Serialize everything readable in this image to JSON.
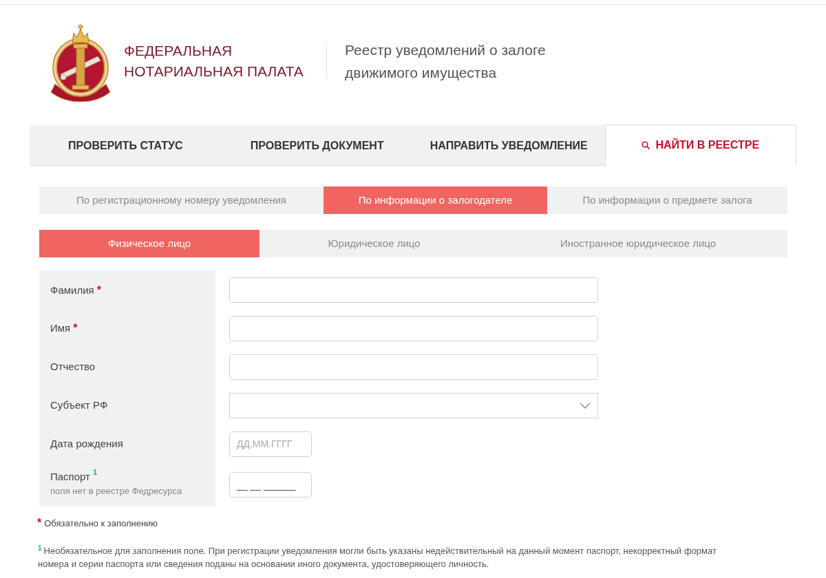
{
  "header": {
    "org_name": "ФЕДЕРАЛЬНАЯ\nНОТАРИАЛЬНАЯ ПАЛАТА",
    "service_name": "Реестр уведомлений о залоге\nдвижимого имущества"
  },
  "nav_tabs": [
    {
      "label": "ПРОВЕРИТЬ СТАТУС",
      "kind": "plain",
      "selected": false
    },
    {
      "label": "ПРОВЕРИТЬ ДОКУМЕНТ",
      "kind": "plain",
      "selected": false
    },
    {
      "label": "НАПРАВИТЬ УВЕДОМЛЕНИЕ",
      "kind": "plain",
      "selected": false
    },
    {
      "label": "НАЙТИ В РЕЕСТРЕ",
      "kind": "search",
      "selected": true
    }
  ],
  "search_modes": [
    {
      "label": "По регистрационному номеру уведомления",
      "selected": false
    },
    {
      "label": "По информации о залогодателе",
      "selected": true
    },
    {
      "label": "По информации о предмете залога",
      "selected": false
    }
  ],
  "person_types": [
    {
      "label": "Физическое лицо",
      "selected": true
    },
    {
      "label": "Юридическое лицо",
      "selected": false
    },
    {
      "label": "Иностранное юридическое лицо",
      "selected": false
    }
  ],
  "form": {
    "fields": [
      {
        "label": "Фамилия",
        "required_mark": "*",
        "kind": "text"
      },
      {
        "label": "Имя",
        "required_mark": "*",
        "kind": "text"
      },
      {
        "label": "Отчество",
        "kind": "text"
      },
      {
        "label": "Субъект РФ",
        "kind": "select"
      },
      {
        "label": "Дата рождения",
        "kind": "date",
        "placeholder": "ДД.ММ.ГГГГ"
      },
      {
        "label": "Паспорт",
        "footnote_mark": "1",
        "note": "поля нет в реестре Федресурса",
        "kind": "masked",
        "value": "__ __ ______"
      }
    ]
  },
  "required_legend": {
    "mark": "*",
    "text": "Обязательно к заполнению"
  },
  "footnote": {
    "mark": "1",
    "text": "Необязательное для заполнения поле. При регистрации уведомления могли быть указаны недействительный на данный момент паспорт, некорректный формат номера и серии паспорта или сведения поданы на основании иного документа, удостоверяющего личность."
  }
}
